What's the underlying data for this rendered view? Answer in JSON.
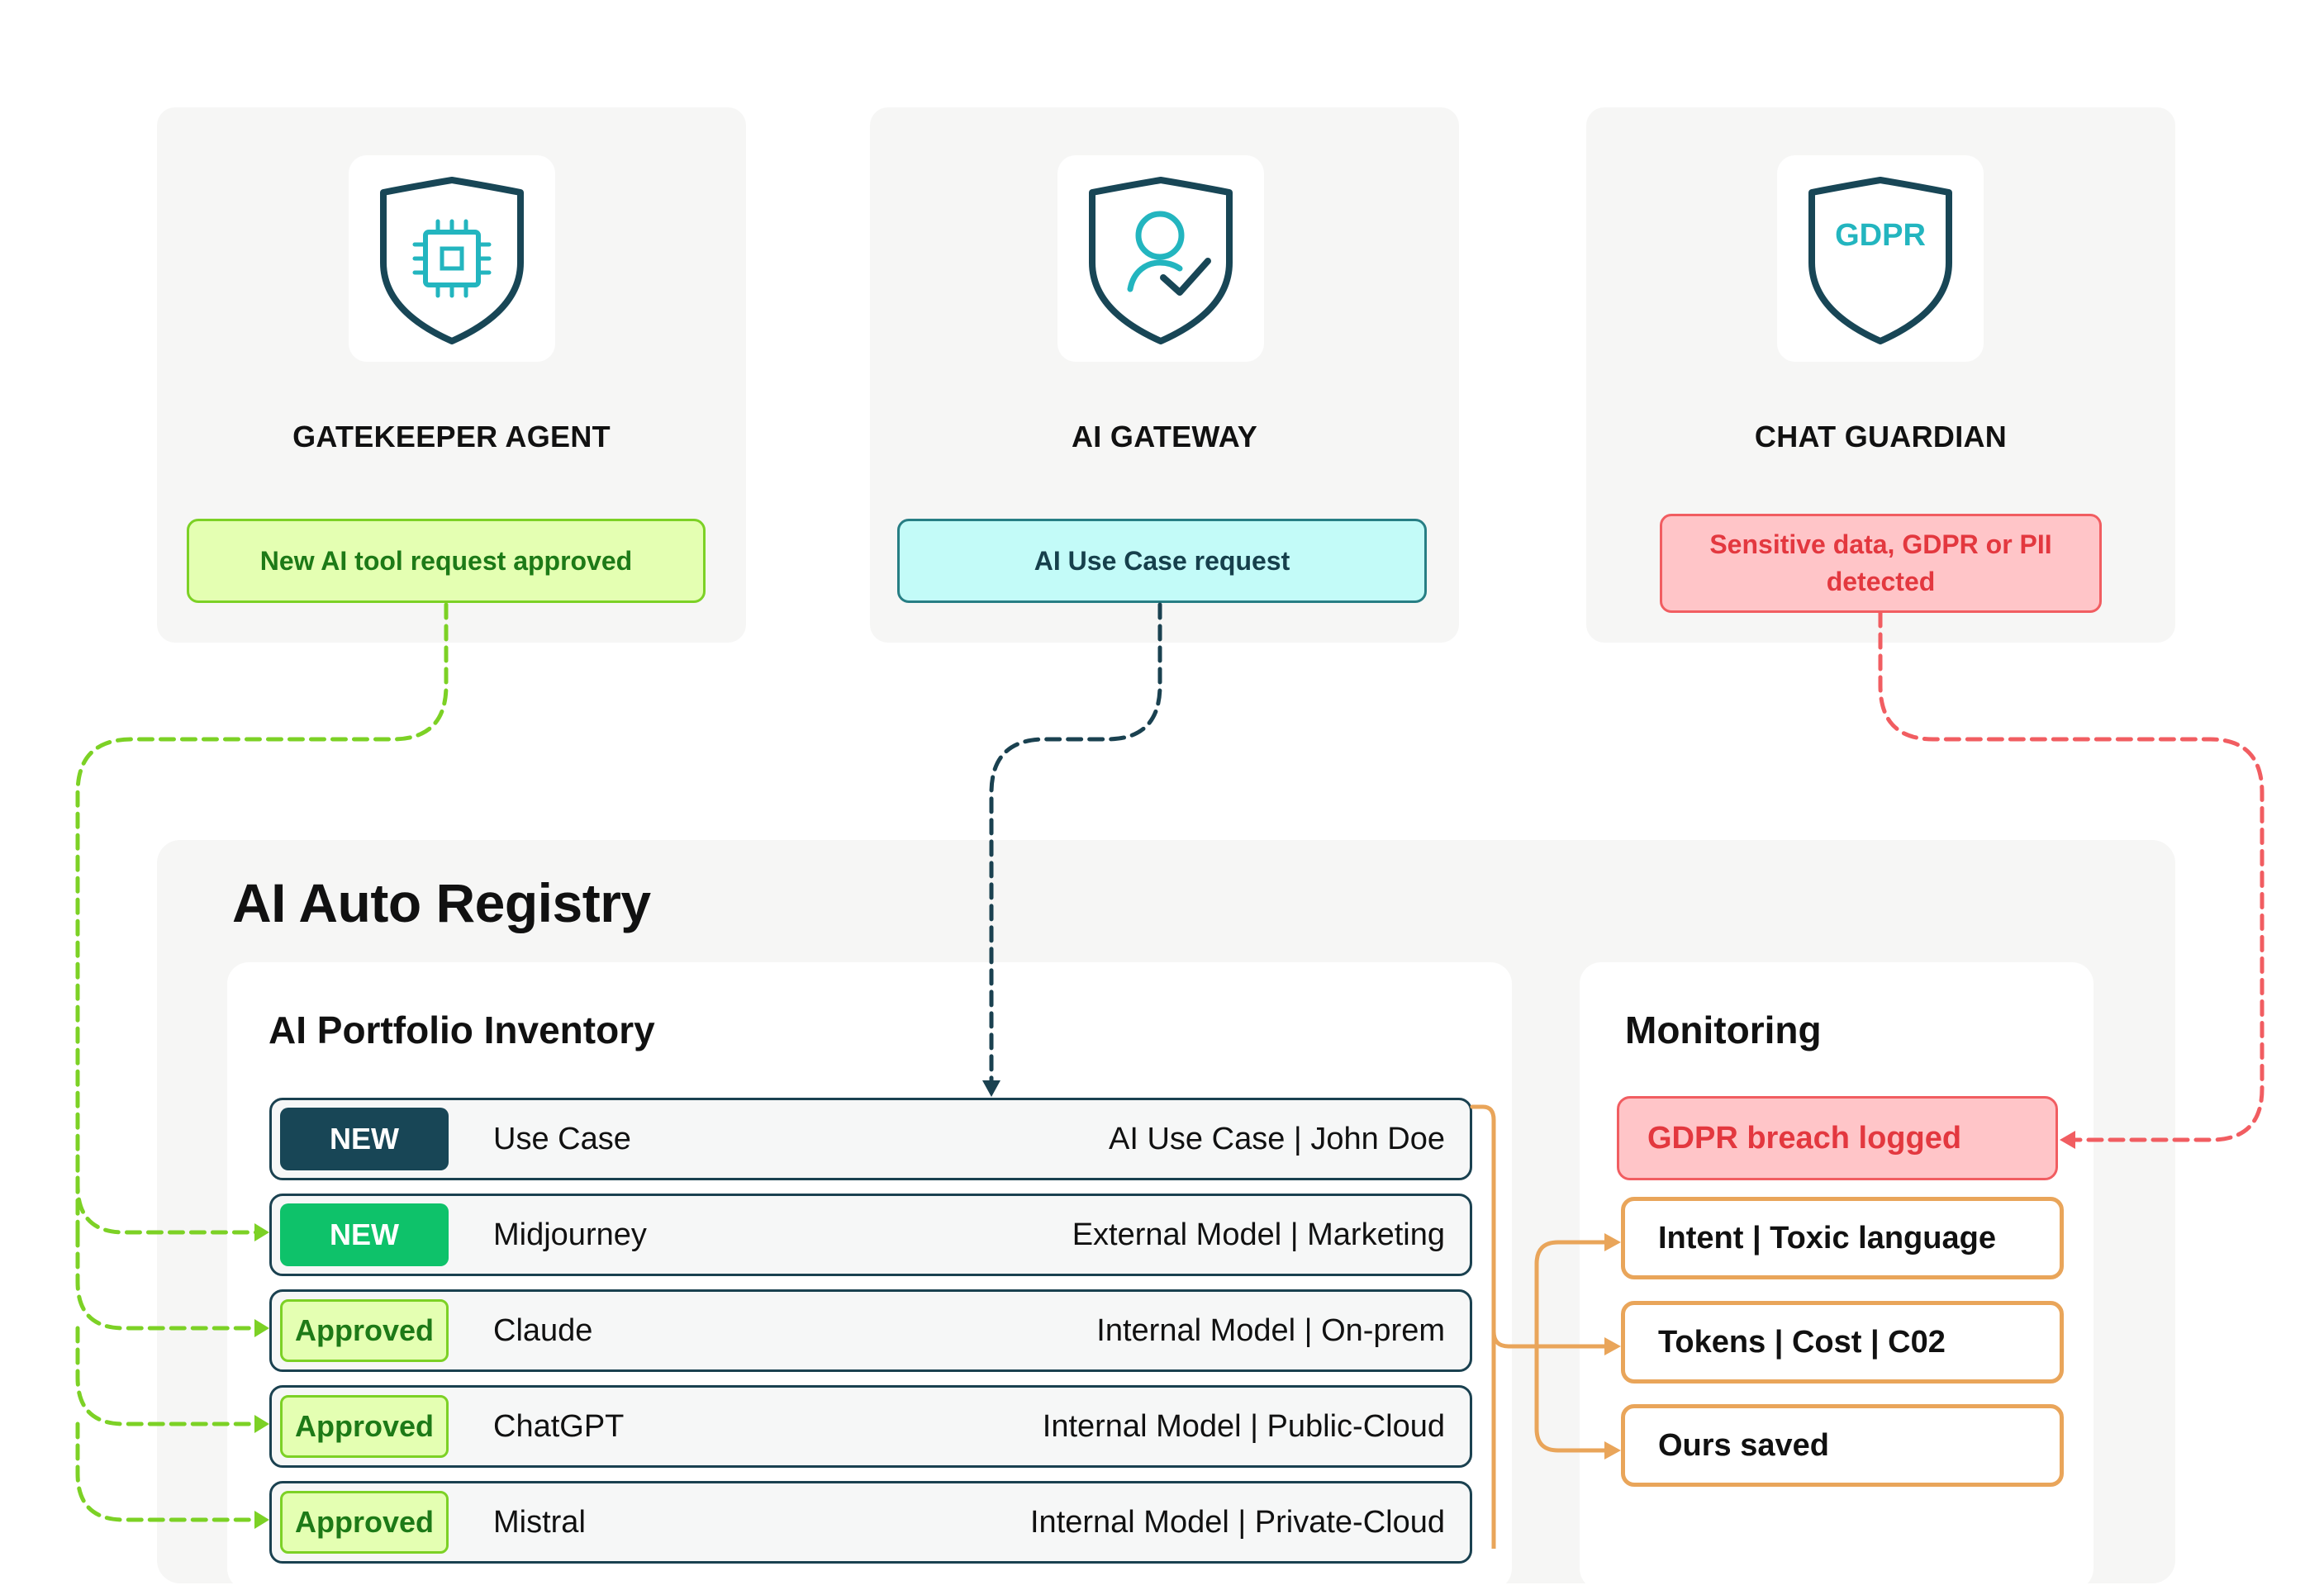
{
  "agents": [
    {
      "title": "GATEKEEPER AGENT",
      "event": "New AI tool request approved",
      "icon": "shield-chip-icon"
    },
    {
      "title": "AI GATEWAY",
      "event": "AI Use Case request",
      "icon": "shield-user-check-icon"
    },
    {
      "title": "CHAT GUARDIAN",
      "event": "Sensitive data, GDPR or PII detected",
      "icon": "shield-gdpr-icon",
      "icon_text": "GDPR"
    }
  ],
  "registry": {
    "title": "AI Auto Registry",
    "inventory": {
      "title": "AI Portfolio Inventory",
      "rows": [
        {
          "status": "NEW",
          "name": "Use Case",
          "meta": "AI Use Case | John Doe"
        },
        {
          "status": "NEW",
          "name": "Midjourney",
          "meta": "External Model | Marketing"
        },
        {
          "status": "Approved",
          "name": "Claude",
          "meta": "Internal Model | On-prem"
        },
        {
          "status": "Approved",
          "name": "ChatGPT",
          "meta": "Internal Model | Public-Cloud"
        },
        {
          "status": "Approved",
          "name": "Mistral",
          "meta": "Internal Model | Private-Cloud"
        }
      ]
    },
    "monitoring": {
      "title": "Monitoring",
      "items": [
        "GDPR breach logged",
        "Intent | Toxic language",
        "Tokens | Cost | C02",
        "Ours saved"
      ]
    }
  },
  "colors": {
    "green": "#7cd125",
    "navy": "#1a4150",
    "cyan": "#23b5bf",
    "red": "#f15d61",
    "orange": "#e9a55a",
    "new_green": "#0ec26a"
  }
}
